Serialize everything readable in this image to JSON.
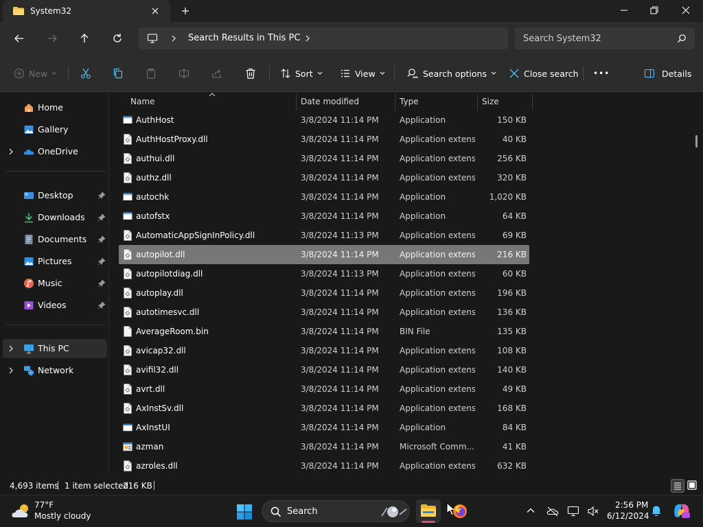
{
  "window": {
    "tab_title": "System32",
    "minimize_glyph": "—",
    "colors": {
      "accent": "#0078d4",
      "selection": "#777777",
      "folder": "#f2c55c"
    }
  },
  "address": {
    "breadcrumb": "Search Results in This PC",
    "search_placeholder": "Search System32"
  },
  "commands": {
    "new": "New",
    "sort": "Sort",
    "view": "View",
    "search_options": "Search options",
    "close_search": "Close search",
    "more": "•••",
    "details": "Details"
  },
  "sidebar": {
    "items": [
      {
        "label": "Home",
        "icon": "home-icon"
      },
      {
        "label": "Gallery",
        "icon": "gallery-icon"
      },
      {
        "label": "OneDrive",
        "icon": "onedrive-icon",
        "expandable": true
      },
      {
        "label": "Desktop",
        "icon": "desktop-icon",
        "pinned": true
      },
      {
        "label": "Downloads",
        "icon": "downloads-icon",
        "pinned": true
      },
      {
        "label": "Documents",
        "icon": "documents-icon",
        "pinned": true
      },
      {
        "label": "Pictures",
        "icon": "pictures-icon",
        "pinned": true
      },
      {
        "label": "Music",
        "icon": "music-icon",
        "pinned": true
      },
      {
        "label": "Videos",
        "icon": "videos-icon",
        "pinned": true
      },
      {
        "label": "This PC",
        "icon": "this-pc-icon",
        "expandable": true,
        "selected": true
      },
      {
        "label": "Network",
        "icon": "network-icon",
        "expandable": true
      }
    ]
  },
  "columns": {
    "name": "Name",
    "date": "Date modified",
    "type": "Type",
    "size": "Size"
  },
  "files": [
    {
      "name": "AuthHost",
      "date": "3/8/2024 11:14 PM",
      "type": "Application",
      "size": "150 KB",
      "icon": "application-icon"
    },
    {
      "name": "AuthHostProxy.dll",
      "date": "3/8/2024 11:14 PM",
      "type": "Application extens...",
      "size": "40 KB",
      "icon": "dll-icon"
    },
    {
      "name": "authui.dll",
      "date": "3/8/2024 11:14 PM",
      "type": "Application extens...",
      "size": "256 KB",
      "icon": "dll-icon"
    },
    {
      "name": "authz.dll",
      "date": "3/8/2024 11:14 PM",
      "type": "Application extens...",
      "size": "320 KB",
      "icon": "dll-icon"
    },
    {
      "name": "autochk",
      "date": "3/8/2024 11:14 PM",
      "type": "Application",
      "size": "1,020 KB",
      "icon": "application-icon"
    },
    {
      "name": "autofstx",
      "date": "3/8/2024 11:14 PM",
      "type": "Application",
      "size": "64 KB",
      "icon": "application-icon"
    },
    {
      "name": "AutomaticAppSignInPolicy.dll",
      "date": "3/8/2024 11:13 PM",
      "type": "Application extens...",
      "size": "69 KB",
      "icon": "dll-icon"
    },
    {
      "name": "autopilot.dll",
      "date": "3/8/2024 11:14 PM",
      "type": "Application extens...",
      "size": "216 KB",
      "icon": "dll-icon",
      "selected": true
    },
    {
      "name": "autopilotdiag.dll",
      "date": "3/8/2024 11:13 PM",
      "type": "Application extens...",
      "size": "60 KB",
      "icon": "dll-icon"
    },
    {
      "name": "autoplay.dll",
      "date": "3/8/2024 11:14 PM",
      "type": "Application extens...",
      "size": "196 KB",
      "icon": "dll-icon"
    },
    {
      "name": "autotimesvc.dll",
      "date": "3/8/2024 11:14 PM",
      "type": "Application extens...",
      "size": "136 KB",
      "icon": "dll-icon"
    },
    {
      "name": "AverageRoom.bin",
      "date": "3/8/2024 11:14 PM",
      "type": "BIN File",
      "size": "135 KB",
      "icon": "file-icon"
    },
    {
      "name": "avicap32.dll",
      "date": "3/8/2024 11:14 PM",
      "type": "Application extens...",
      "size": "108 KB",
      "icon": "dll-icon"
    },
    {
      "name": "avifil32.dll",
      "date": "3/8/2024 11:14 PM",
      "type": "Application extens...",
      "size": "140 KB",
      "icon": "dll-icon"
    },
    {
      "name": "avrt.dll",
      "date": "3/8/2024 11:14 PM",
      "type": "Application extens...",
      "size": "49 KB",
      "icon": "dll-icon"
    },
    {
      "name": "AxInstSv.dll",
      "date": "3/8/2024 11:14 PM",
      "type": "Application extens...",
      "size": "168 KB",
      "icon": "dll-icon"
    },
    {
      "name": "AxInstUI",
      "date": "3/8/2024 11:14 PM",
      "type": "Application",
      "size": "84 KB",
      "icon": "window-app-icon"
    },
    {
      "name": "azman",
      "date": "3/8/2024 11:14 PM",
      "type": "Microsoft Comm...",
      "size": "41 KB",
      "icon": "msc-icon"
    },
    {
      "name": "azroles.dll",
      "date": "3/8/2024 11:14 PM",
      "type": "Application extens...",
      "size": "632 KB",
      "icon": "dll-icon"
    }
  ],
  "status": {
    "item_count": "4,693 items",
    "selection": "1 item selected",
    "selection_size": "216 KB"
  },
  "taskbar": {
    "temperature": "77°F",
    "weather": "Mostly cloudy",
    "search_label": "Search",
    "time": "2:56 PM",
    "date": "6/12/2024"
  }
}
